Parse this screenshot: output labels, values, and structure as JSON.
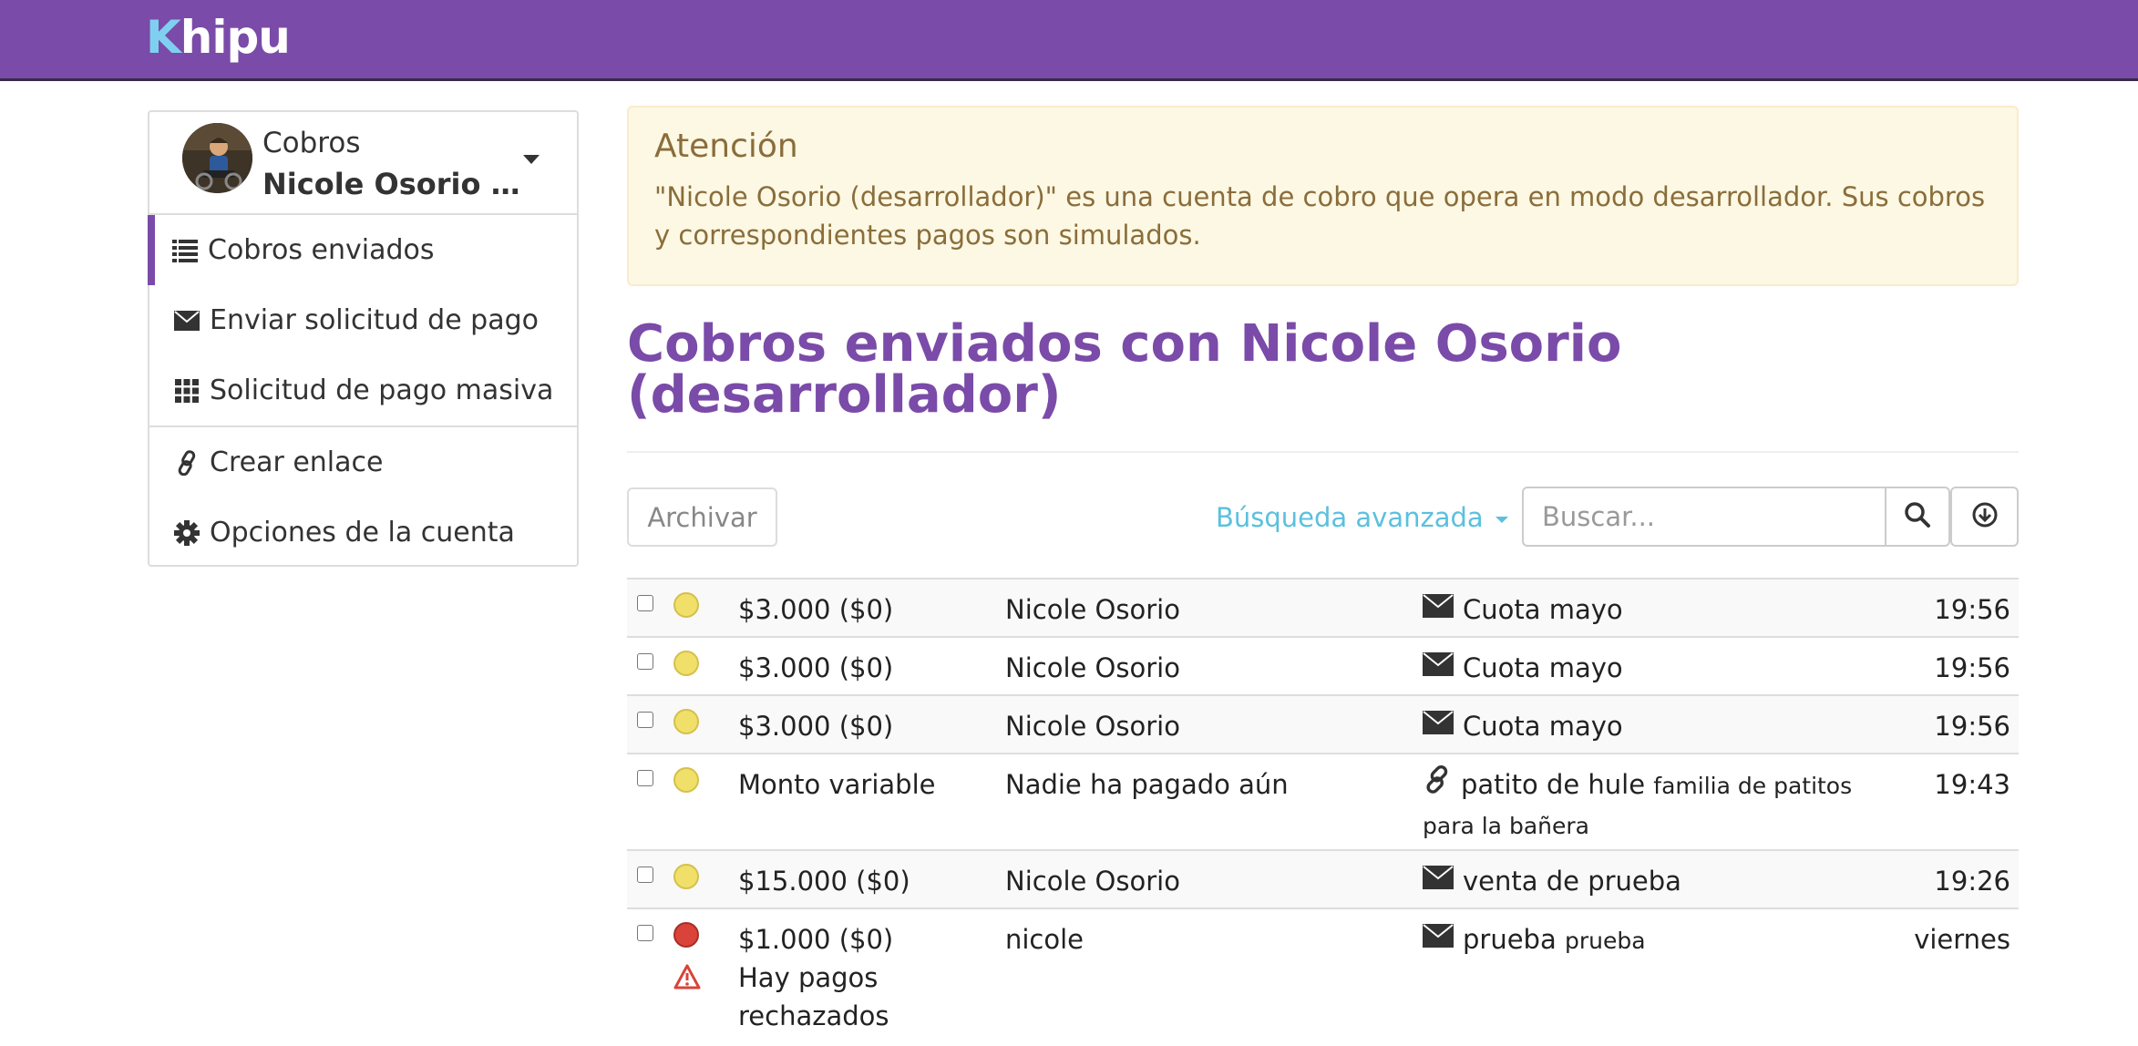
{
  "brand": {
    "logo_k": "K",
    "logo_rest": "hipu",
    "accent": "#7a4ba8",
    "logo_k_color": "#7fd0f0"
  },
  "sidebar": {
    "account_type": "Cobros",
    "account_name": "Nicole Osorio (desarrollador)",
    "items": [
      {
        "label": "Cobros enviados",
        "icon": "list-icon"
      },
      {
        "label": "Enviar solicitud de pago",
        "icon": "envelope-icon"
      },
      {
        "label": "Solicitud de pago masiva",
        "icon": "grid-icon"
      },
      {
        "label": "Crear enlace",
        "icon": "link-icon"
      },
      {
        "label": "Opciones de la cuenta",
        "icon": "gear-icon"
      }
    ]
  },
  "alert": {
    "title": "Atención",
    "body": "\"Nicole Osorio (desarrollador)\" es una cuenta de cobro que opera en modo desarrollador. Sus cobros y correspondientes pagos son simulados."
  },
  "page_title": "Cobros enviados con Nicole Osorio (desarrollador)",
  "toolbar": {
    "archive_label": "Archivar",
    "advanced_search_label": "Búsqueda avanzada",
    "search_placeholder": "Buscar..."
  },
  "rows": [
    {
      "status": "pending",
      "amount": "$3.000 ($0)",
      "payer": "Nicole Osorio",
      "subject_icon": "envelope-icon",
      "subject": "Cuota mayo",
      "detail": "",
      "time": "19:56"
    },
    {
      "status": "pending",
      "amount": "$3.000 ($0)",
      "payer": "Nicole Osorio",
      "subject_icon": "envelope-icon",
      "subject": "Cuota mayo",
      "detail": "",
      "time": "19:56"
    },
    {
      "status": "pending",
      "amount": "$3.000 ($0)",
      "payer": "Nicole Osorio",
      "subject_icon": "envelope-icon",
      "subject": "Cuota mayo",
      "detail": "",
      "time": "19:56"
    },
    {
      "status": "pending",
      "amount": "Monto variable",
      "payer": "Nadie ha pagado aún",
      "subject_icon": "link-icon",
      "subject": "patito de hule",
      "detail": "familia de patitos para la bañera",
      "time": "19:43"
    },
    {
      "status": "pending",
      "amount": "$15.000 ($0)",
      "payer": "Nicole Osorio",
      "subject_icon": "envelope-icon",
      "subject": "venta de prueba",
      "detail": "",
      "time": "19:26"
    },
    {
      "status": "error",
      "amount": "$1.000 ($0)",
      "note": "Hay pagos rechazados",
      "payer": "nicole",
      "subject_icon": "envelope-icon",
      "subject": "prueba",
      "detail": "prueba",
      "time": "viernes"
    }
  ]
}
